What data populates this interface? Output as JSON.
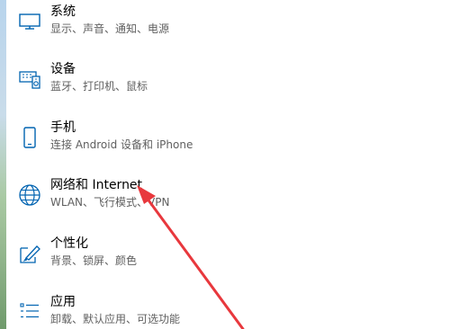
{
  "accent_color": "#0063b1",
  "annotation_color": "#e8383d",
  "settings": {
    "items": [
      {
        "key": "system",
        "title": "系统",
        "subtitle": "显示、声音、通知、电源",
        "icon": "monitor-icon"
      },
      {
        "key": "devices",
        "title": "设备",
        "subtitle": "蓝牙、打印机、鼠标",
        "icon": "keyboard-speaker-icon"
      },
      {
        "key": "phone",
        "title": "手机",
        "subtitle": "连接 Android 设备和 iPhone",
        "icon": "phone-icon"
      },
      {
        "key": "network",
        "title": "网络和 Internet",
        "subtitle": "WLAN、飞行模式、VPN",
        "icon": "globe-icon"
      },
      {
        "key": "personalization",
        "title": "个性化",
        "subtitle": "背景、锁屏、颜色",
        "icon": "paintbrush-icon"
      },
      {
        "key": "apps",
        "title": "应用",
        "subtitle": "卸载、默认应用、可选功能",
        "icon": "list-icon"
      }
    ]
  }
}
